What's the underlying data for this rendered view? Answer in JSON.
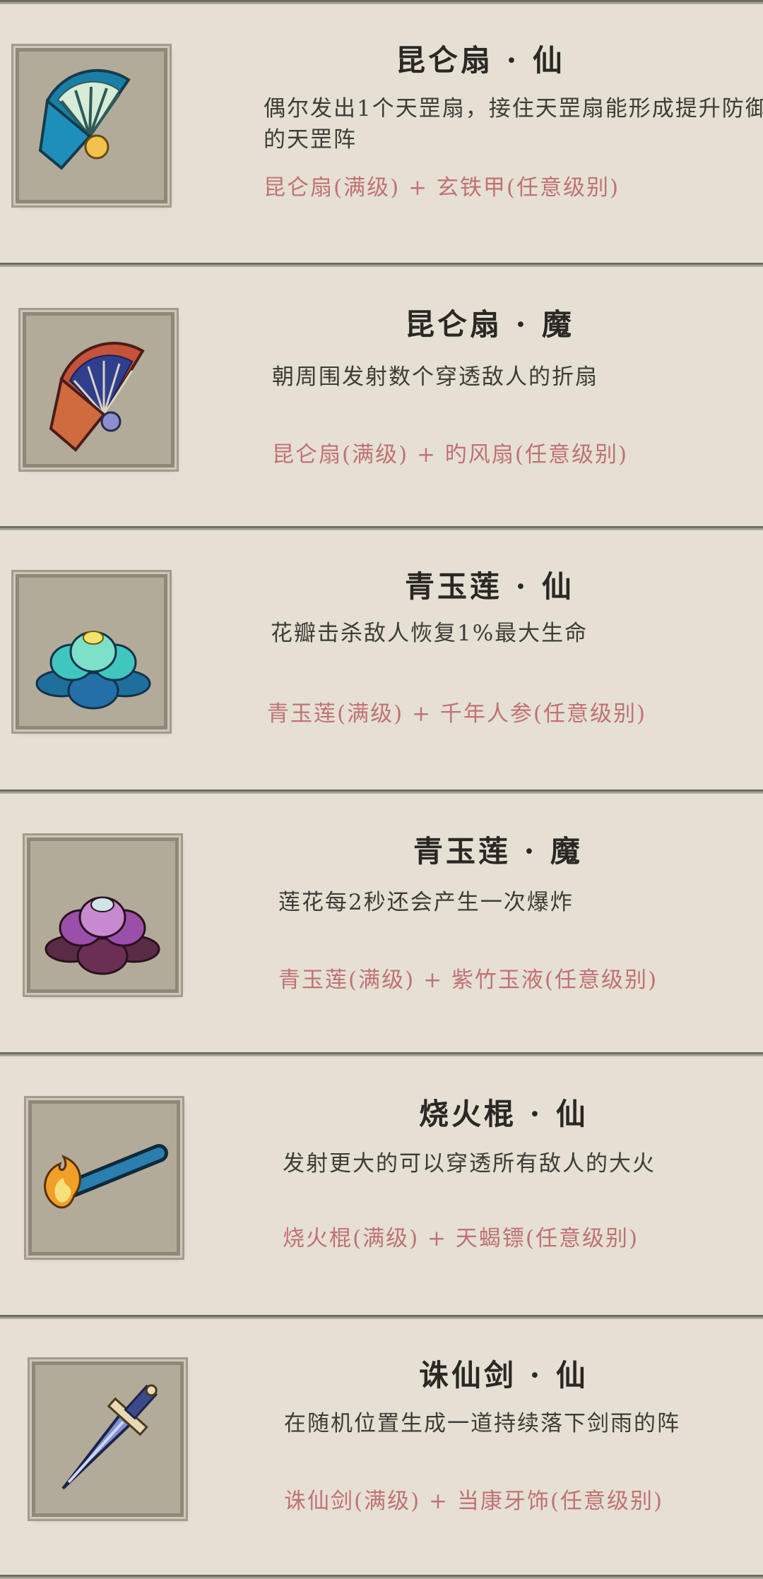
{
  "cards": [
    {
      "title": "昆仑扇 · 仙",
      "description": "偶尔发出1个天罡扇，接住天罡扇能形成提升防御的天罡阵",
      "recipe": "昆仑扇(满级) + 玄铁甲(任意级别)",
      "icon": "teal-fan-icon"
    },
    {
      "title": "昆仑扇 · 魔",
      "description": "朝周围发射数个穿透敌人的折扇",
      "recipe": "昆仑扇(满级) + 旳风扇(任意级别)",
      "icon": "red-fan-icon"
    },
    {
      "title": "青玉莲 · 仙",
      "description": "花瓣击杀敌人恢复1%最大生命",
      "recipe": "青玉莲(满级) + 千年人参(任意级别)",
      "icon": "teal-lotus-icon"
    },
    {
      "title": "青玉莲 · 魔",
      "description": "莲花每2秒还会产生一次爆炸",
      "recipe": "青玉莲(满级) + 紫竹玉液(任意级别)",
      "icon": "purple-lotus-icon"
    },
    {
      "title": "烧火棍 · 仙",
      "description": "发射更大的可以穿透所有敌人的大火",
      "recipe": "烧火棍(满级) + 天蝎镖(任意级别)",
      "icon": "fire-stick-icon"
    },
    {
      "title": "诛仙剑 · 仙",
      "description": "在随机位置生成一道持续落下剑雨的阵",
      "recipe": "诛仙剑(满级) + 当康牙饰(任意级别)",
      "icon": "sword-icon"
    }
  ]
}
